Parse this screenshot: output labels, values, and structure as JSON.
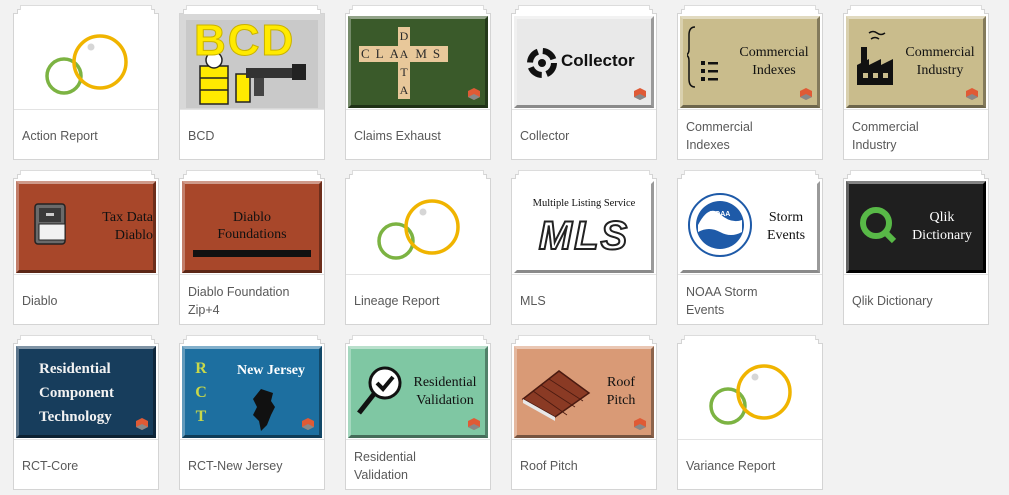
{
  "apps": [
    {
      "name": "Action Report"
    },
    {
      "name": "BCD",
      "thumb_text": "BCD"
    },
    {
      "name": "Claims Exhaust",
      "thumb_text": "CLAIMS",
      "thumb_text_2": "DATA"
    },
    {
      "name": "Collector",
      "thumb_text": "Collector"
    },
    {
      "name": "Commercial Indexes",
      "thumb_text": "Commercial",
      "thumb_text_2": "Indexes"
    },
    {
      "name": "Commercial Industry",
      "thumb_text": "Commercial",
      "thumb_text_2": "Industry"
    },
    {
      "name": "Diablo",
      "thumb_text": "Tax Data",
      "thumb_text_2": "Diablo"
    },
    {
      "name": "Diablo Foundation Zip+4",
      "thumb_text": "Diablo",
      "thumb_text_2": "Foundations"
    },
    {
      "name": "Lineage Report"
    },
    {
      "name": "MLS",
      "thumb_text": "Multiple Listing Service",
      "thumb_text_2": "MLS"
    },
    {
      "name": "NOAA Storm Events",
      "thumb_text": "Storm",
      "thumb_text_2": "Events",
      "thumb_text_3": "NOAA"
    },
    {
      "name": "Qlik Dictionary",
      "thumb_text": "Qlik",
      "thumb_text_2": "Dictionary"
    },
    {
      "name": "RCT-Core",
      "thumb_text": "Residential",
      "thumb_text_2": "Component",
      "thumb_text_3": "Technology"
    },
    {
      "name": "RCT-New Jersey",
      "thumb_text": "New Jersey",
      "thumb_text_2": "RCT"
    },
    {
      "name": "Residential Validation",
      "thumb_text": "Residential",
      "thumb_text_2": "Validation"
    },
    {
      "name": "Roof Pitch",
      "thumb_text": "Roof",
      "thumb_text_2": "Pitch"
    },
    {
      "name": "Variance Report"
    }
  ],
  "colors": {
    "page_bg": "#f2f2f2",
    "default_circle_green": "#7cb342",
    "default_circle_yellow": "#f0b400",
    "bcd_yellow": "#ffea00",
    "claims_green": "#3a5a2a",
    "commercial_tan": "#c9bc8c",
    "diablo_red": "#a8472a",
    "nj_blue": "#1d6fa0",
    "rct_blue": "#173d5c",
    "validation_green": "#7fc7a3",
    "roof_salmon": "#d99a76",
    "qlik_dark": "#1f1f1f"
  }
}
